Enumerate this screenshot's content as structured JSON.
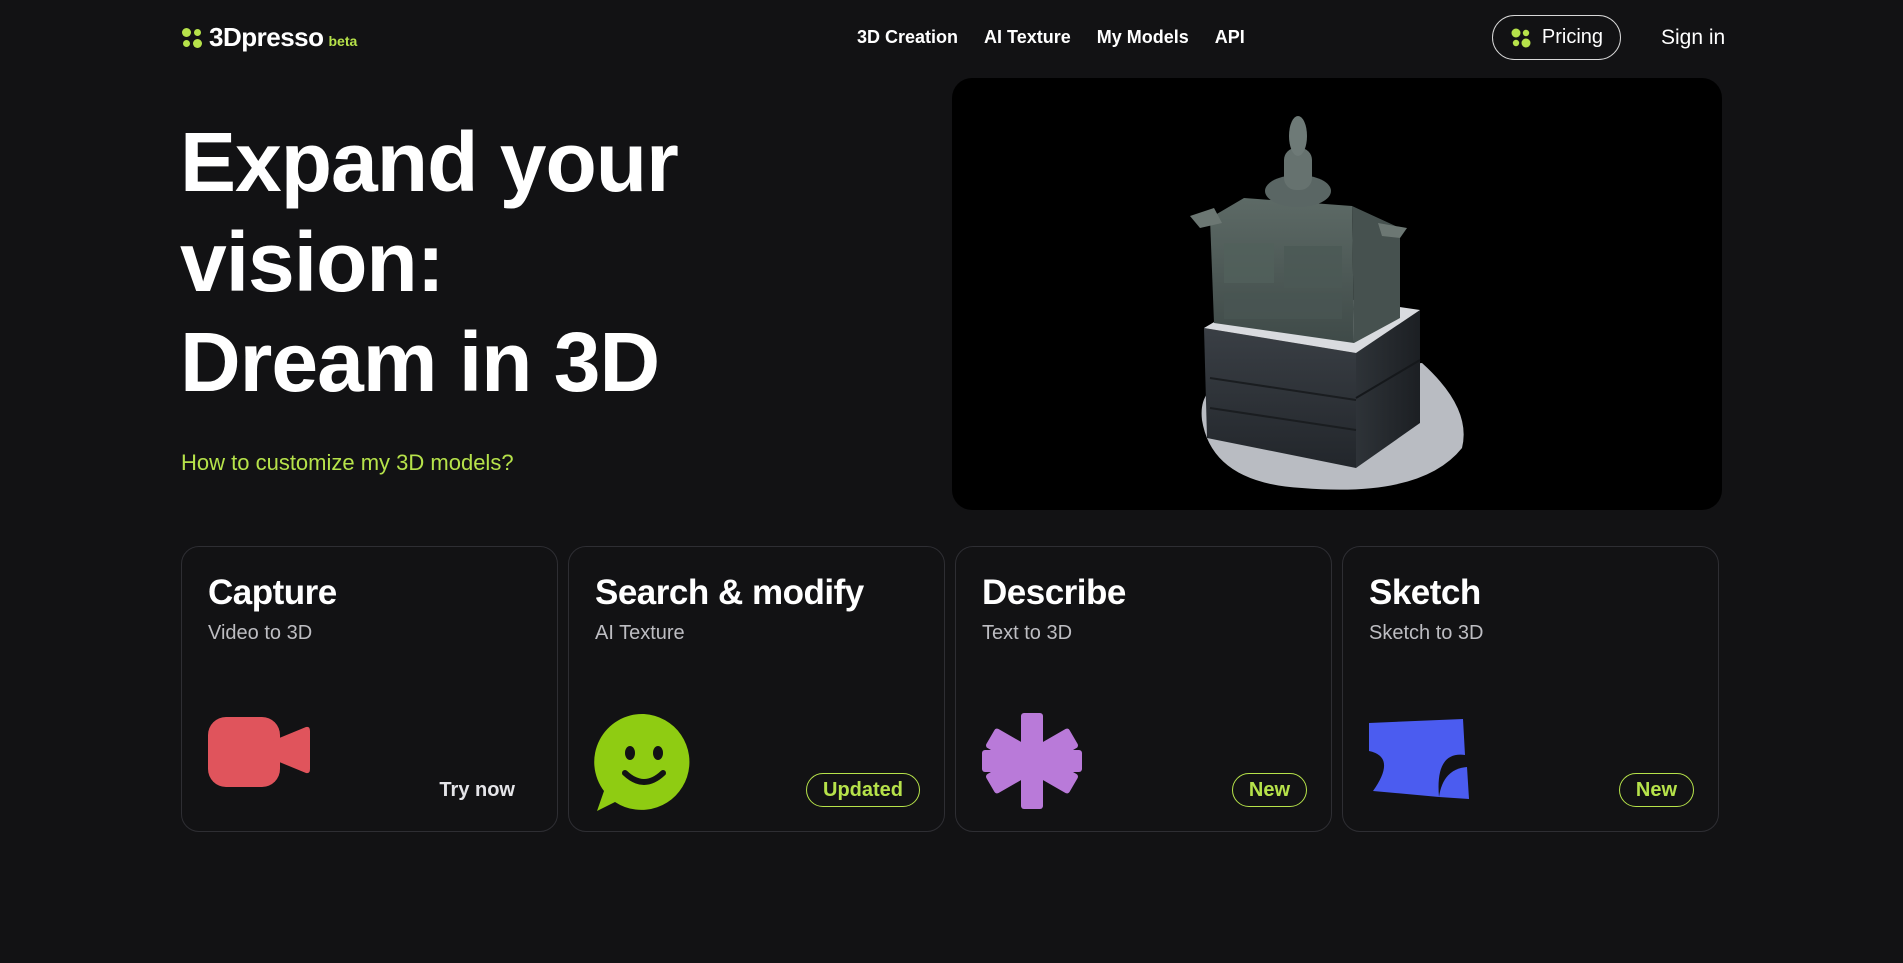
{
  "brand": {
    "name": "3Dpresso",
    "tag": "beta",
    "accent": "#b6e24a"
  },
  "nav": {
    "items": [
      "3D Creation",
      "AI Texture",
      "My Models",
      "API"
    ]
  },
  "header": {
    "pricing_label": "Pricing",
    "signin_label": "Sign in"
  },
  "hero": {
    "title_line1": "Expand your",
    "title_line2": "vision:",
    "title_line3": "Dream in 3D",
    "help_link": "How to customize my 3D models?"
  },
  "cards": [
    {
      "title": "Capture",
      "subtitle": "Video to 3D",
      "action": "Try now",
      "icon": "video-camera-icon",
      "color": "#e0545c"
    },
    {
      "title": "Search & modify",
      "subtitle": "AI Texture",
      "badge": "Updated",
      "icon": "smile-chat-icon",
      "color": "#8fcc12"
    },
    {
      "title": "Describe",
      "subtitle": "Text to 3D",
      "badge": "New",
      "icon": "asterisk-icon",
      "color": "#b97ad9"
    },
    {
      "title": "Sketch",
      "subtitle": "Sketch to 3D",
      "badge": "New",
      "icon": "sketch-shape-icon",
      "color": "#4b5cf0"
    }
  ]
}
